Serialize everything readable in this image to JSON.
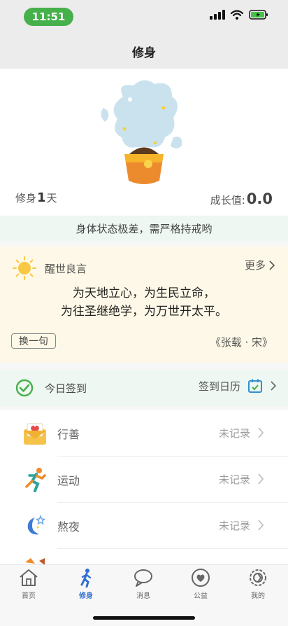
{
  "status_bar": {
    "time": "11:51"
  },
  "header": {
    "title": "修身"
  },
  "hero": {
    "days_prefix": "修身",
    "days_value": "1",
    "days_suffix": "天",
    "growth_label": "成长值:",
    "growth_value": "0.0"
  },
  "status_message": "身体状态极差，需严格持戒哟",
  "quote": {
    "title": "醒世良言",
    "more_label": "更多",
    "line1": "为天地立心，为生民立命，",
    "line2": "为往圣继绝学，为万世开太平。",
    "swap_label": "换一句",
    "author": "《张载 · 宋》"
  },
  "signin": {
    "label": "今日签到",
    "calendar_label": "签到日历"
  },
  "records": [
    {
      "label": "行善",
      "status": "未记录",
      "icon": "envelope-heart-icon"
    },
    {
      "label": "运动",
      "status": "未记录",
      "icon": "runner-icon"
    },
    {
      "label": "熬夜",
      "status": "未记录",
      "icon": "moon-star-icon"
    }
  ],
  "tabs": [
    {
      "label": "首页",
      "icon": "home-icon"
    },
    {
      "label": "修身",
      "icon": "walking-person-icon",
      "active": true
    },
    {
      "label": "消息",
      "icon": "chat-bubble-icon"
    },
    {
      "label": "公益",
      "icon": "heart-circle-icon"
    },
    {
      "label": "我的",
      "icon": "profile-gear-icon"
    }
  ],
  "colors": {
    "accent": "#2f6fd0",
    "green": "#46b04a",
    "quote_bg": "#fdf8e7",
    "mint_bg": "#eef7f2"
  }
}
